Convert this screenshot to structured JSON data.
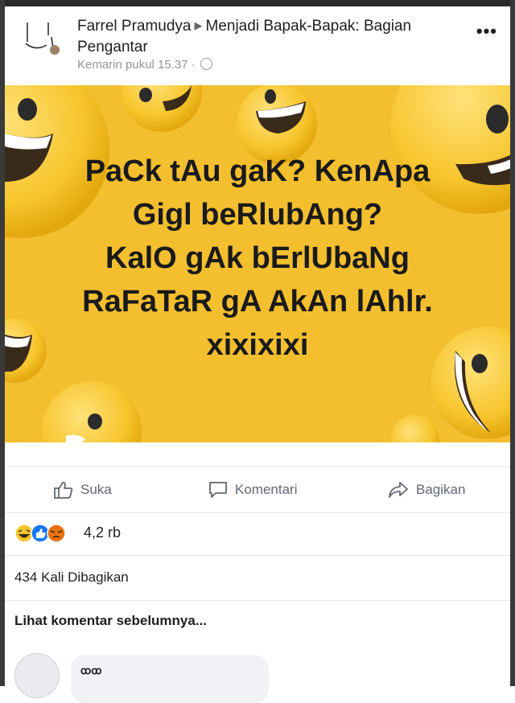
{
  "post": {
    "author": "Farrel Pramudya",
    "group": "Menjadi Bapak-Bapak: Bagian Pengantar",
    "timestamp": "Kemarin pukul 15.37 ·",
    "more_label": "•••",
    "image_text": [
      "PaCk tAu gaK? KenApa",
      "Gigl beRlubAng?",
      "KalO gAk bErlUbaNg",
      "RaFaTaR gA AkAn lAhlr.",
      "xixixixi"
    ],
    "accent_color": "#f3bf2f"
  },
  "actions": {
    "like": "Suka",
    "comment": "Komentari",
    "share": "Bagikan"
  },
  "reactions": {
    "icons": [
      "haha-icon",
      "like-icon",
      "angry-icon"
    ],
    "count": "4,2 rb"
  },
  "shares": "434 Kali Dibagikan",
  "previous_comments": "Lihat komentar sebelumnya...",
  "comment": {
    "name": "ꝏꝏ"
  }
}
